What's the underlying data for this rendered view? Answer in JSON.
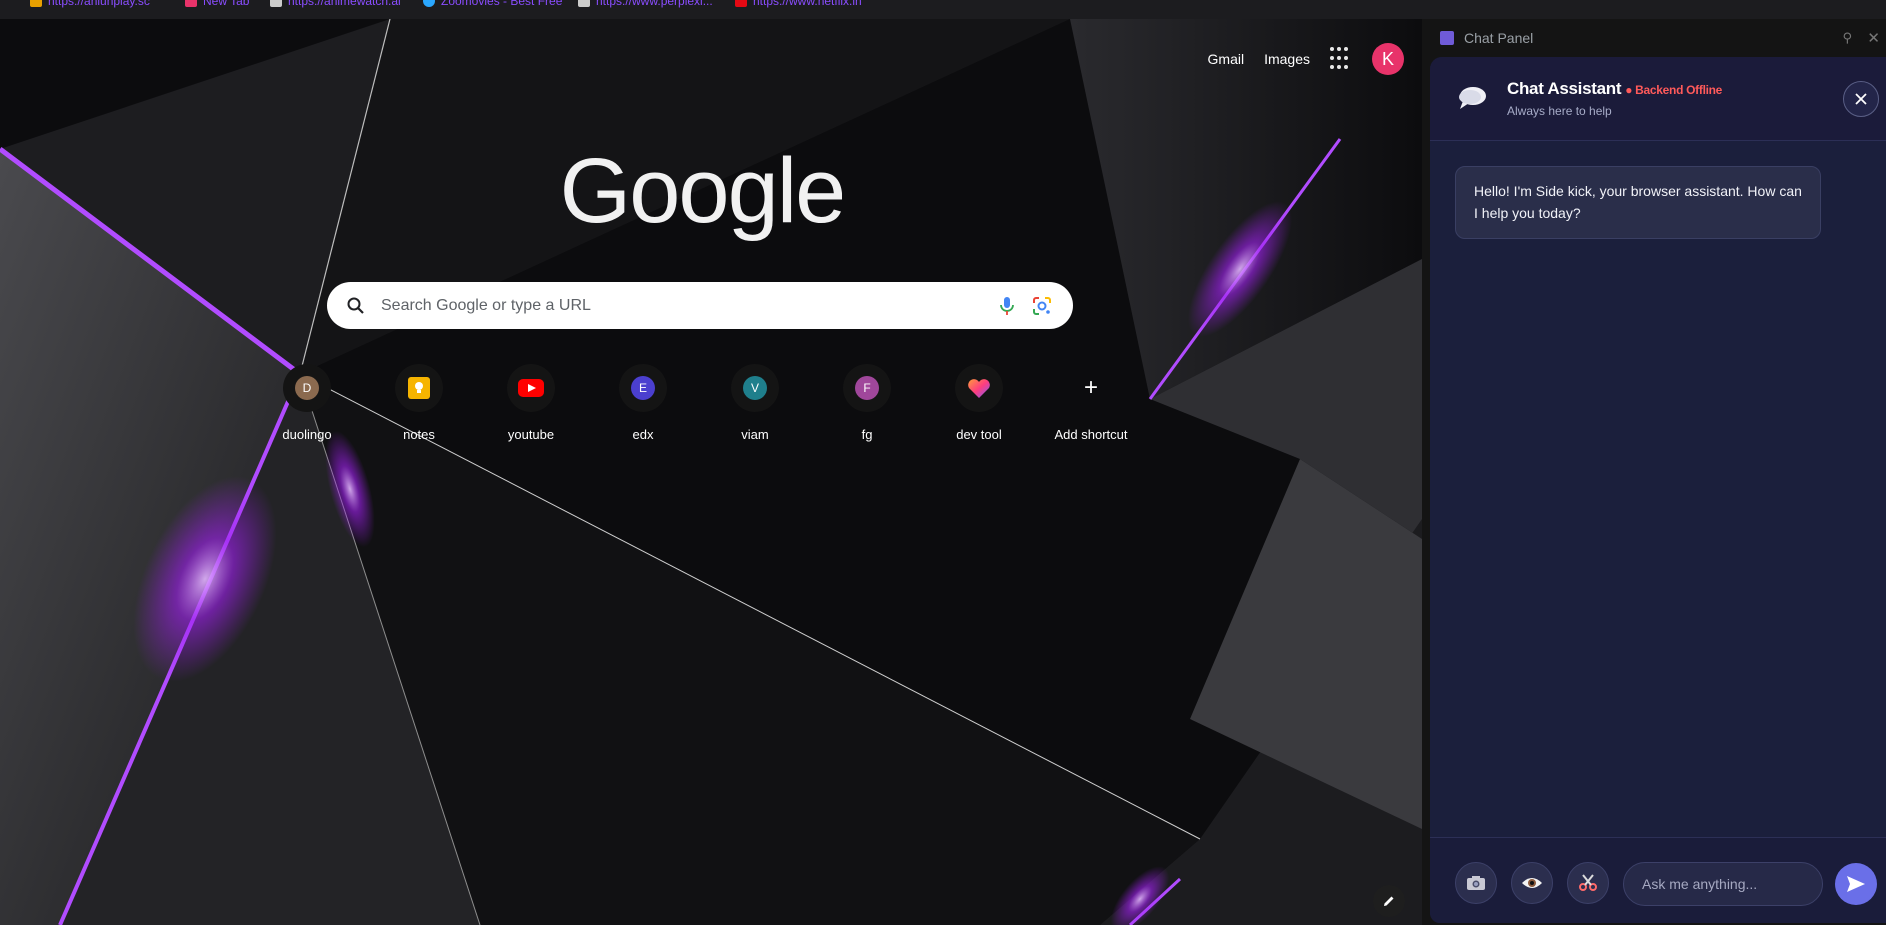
{
  "bookmarks": [
    {
      "label": "https://aniunplay.sc",
      "color": "#e8a000"
    },
    {
      "label": "New Tab",
      "color": "#e8336a"
    },
    {
      "label": "https://animewatch.ai",
      "color": "#cccccc"
    },
    {
      "label": "Zoomovies - Best Free",
      "color": "#2aa7ff"
    },
    {
      "label": "https://www.perplexi...",
      "color": "#cccccc"
    },
    {
      "label": "https://www.netflix.in",
      "color": "#e50914"
    }
  ],
  "top_links": {
    "gmail": "Gmail",
    "images": "Images",
    "avatar_letter": "K"
  },
  "logo_text": "Google",
  "search": {
    "placeholder": "Search Google or type a URL"
  },
  "shortcuts": [
    {
      "label": "duolingo",
      "letter": "D",
      "color": "#8b6a4f"
    },
    {
      "label": "notes",
      "letter": "",
      "color": "#f6b400",
      "icon": "bulb-icon"
    },
    {
      "label": "youtube",
      "letter": "",
      "color": "#ff0000",
      "icon": "play-icon"
    },
    {
      "label": "edx",
      "letter": "E",
      "color": "#4b3fcf"
    },
    {
      "label": "viam",
      "letter": "V",
      "color": "#1f7f8c"
    },
    {
      "label": "fg",
      "letter": "F",
      "color": "#a0479b"
    },
    {
      "label": "dev tool",
      "letter": "",
      "color": "#ff5a5a",
      "icon": "heart-icon"
    },
    {
      "label": "Add shortcut",
      "letter": "+",
      "color": "#141414"
    }
  ],
  "side_panel": {
    "title": "Chat Panel"
  },
  "chat": {
    "title": "Chat Assistant",
    "status": "● Backend Offline",
    "subtitle": "Always here to help",
    "greeting": "Hello! I'm Side kick, your browser assistant. How can I help you today?",
    "input_placeholder": "Ask me anything..."
  },
  "colors": {
    "accent": "#8a2be2",
    "chat_bg": "#1b1f3c",
    "offline": "#ff5a5a"
  }
}
